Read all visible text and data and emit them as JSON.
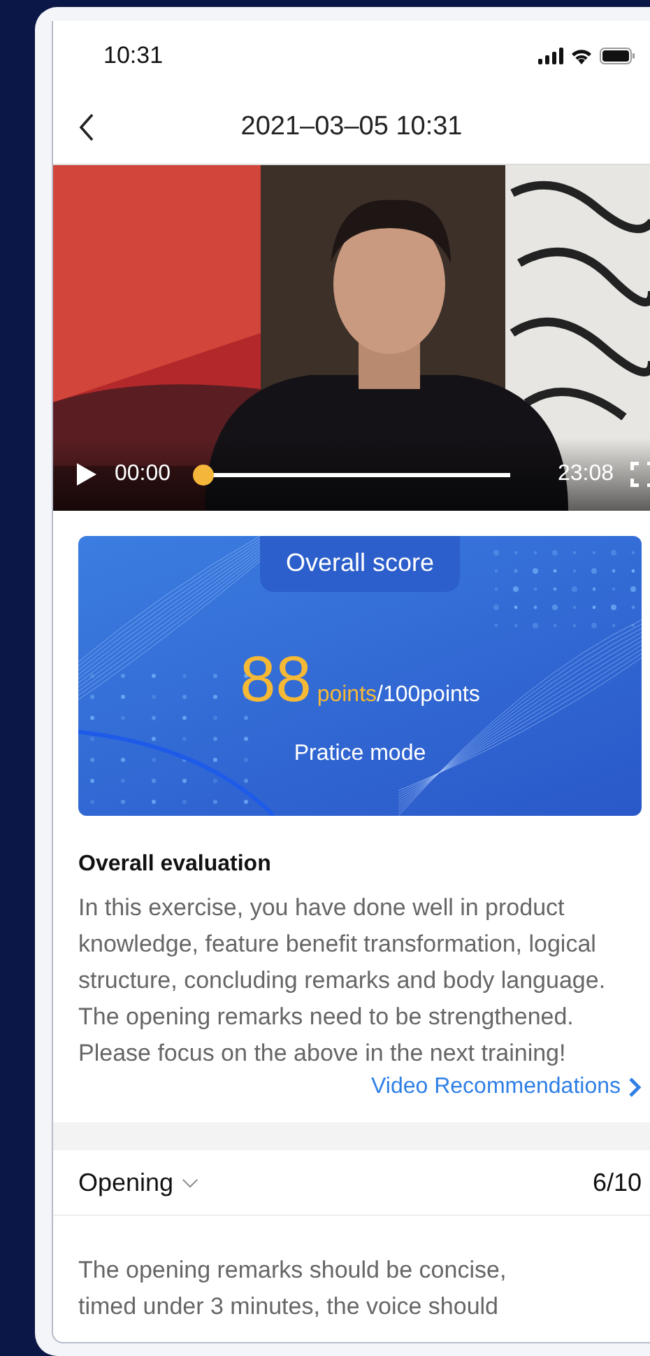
{
  "status_bar": {
    "time": "10:31"
  },
  "header": {
    "title": "2021–03–05 10:31"
  },
  "video": {
    "kind": "picture",
    "playing": false,
    "current_time": "00:00",
    "duration": "23:08",
    "level": 0
  },
  "score_card": {
    "label": "Overall score",
    "score": "88",
    "unit": "points",
    "total": "/100points",
    "mode": "Pratice mode"
  },
  "evaluation": {
    "heading": "Overall evaluation",
    "text": "In this exercise, you have done well in product knowledge, feature benefit transformation, logical structure, concluding remarks and body language. The opening remarks need to be strengthened. Please focus on the above in the next training!",
    "link": "Video Recommendations"
  },
  "sections": [
    {
      "title": "Opening",
      "score": "6/10",
      "lines": [
        "The opening remarks should be concise,",
        "timed under 3 minutes, the voice should"
      ]
    }
  ]
}
